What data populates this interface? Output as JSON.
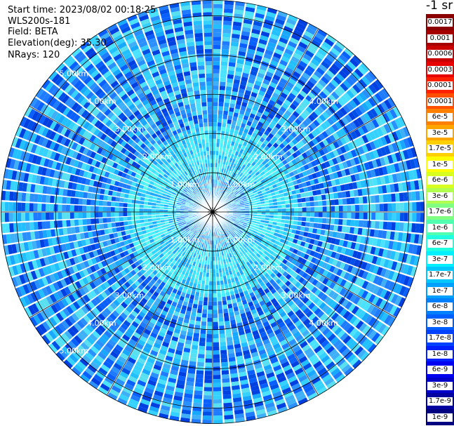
{
  "info": {
    "start_time": "Start time: 2023/08/02 00:18:25",
    "instrument": "WLS200s-181",
    "field": "Field: BETA",
    "elevation": "Elevation(deg): 35.30",
    "nrays": "NRays: 120"
  },
  "colorbar": {
    "unit_label": "-1 sr",
    "labels": [
      "0.0017",
      "0.001",
      "0.0006",
      "0.0003",
      "0.00017",
      "0.0001",
      "6e-5",
      "3e-5",
      "1.7e-5",
      "1e-5",
      "6e-6",
      "3e-6",
      "1.7e-6",
      "1e-6",
      "6e-7",
      "3e-7",
      "1.7e-7",
      "1e-7",
      "6e-8",
      "3e-8",
      "1.7e-8",
      "1e-8",
      "6e-9",
      "3e-9",
      "1.7e-9",
      "1e-9"
    ],
    "colors": [
      "#8b0000",
      "#a50000",
      "#c80000",
      "#e60000",
      "#ff2000",
      "#ff5000",
      "#ff8000",
      "#ffa500",
      "#ffd000",
      "#ffff00",
      "#d8ff20",
      "#b0ff50",
      "#80ff80",
      "#50ffb0",
      "#20ffe0",
      "#00f0ff",
      "#00c8ff",
      "#00a0ff",
      "#0080ff",
      "#0060ff",
      "#0040ff",
      "#0020ff",
      "#0000f0",
      "#0000c8",
      "#0000a0",
      "#000080"
    ]
  },
  "chart_data": {
    "type": "heatmap",
    "projection": "polar PPI scan",
    "field": "BETA",
    "nrays": 120,
    "range_max_km": 5.4,
    "range_rings_km": [
      1,
      2,
      3,
      4,
      5
    ],
    "ring_labels": [
      "1.00km",
      "2.00km",
      "3.00km",
      "4.00km",
      "5.00km"
    ],
    "radial_lines_deg": [
      0,
      30,
      60,
      90,
      120,
      150,
      180,
      210,
      240,
      270,
      300,
      330
    ],
    "scale": "log",
    "value_range": [
      1e-09,
      0.0017
    ]
  }
}
